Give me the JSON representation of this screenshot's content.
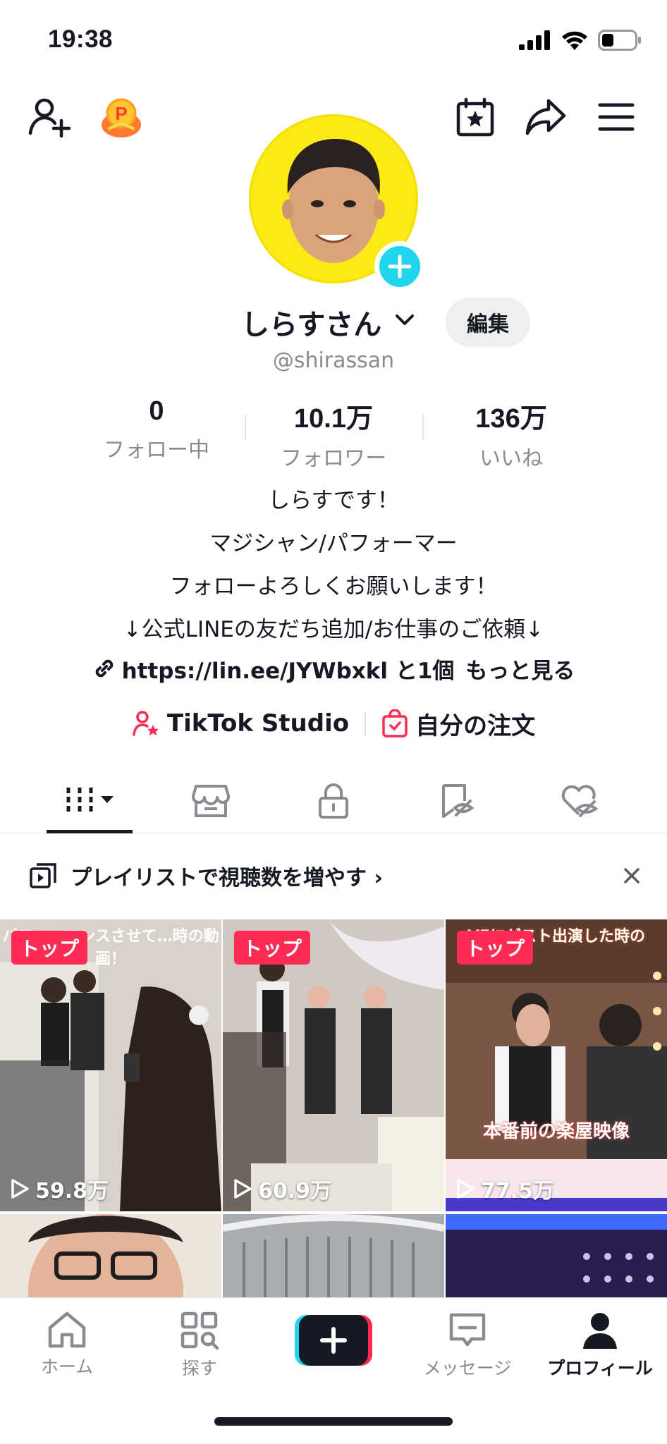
{
  "status": {
    "time": "19:38"
  },
  "profile": {
    "display_name": "しらすさん",
    "username": "@shirassan",
    "edit_label": "編集",
    "stats": [
      {
        "value": "0",
        "label": "フォロー中"
      },
      {
        "value": "10.1万",
        "label": "フォロワー"
      },
      {
        "value": "136万",
        "label": "いいね"
      }
    ],
    "bio_lines": [
      "しらすです！",
      "マジシャン/パフォーマー",
      "フォローよろしくお願いします！",
      "↓公式LINEの友だち追加/お仕事のご依頼↓"
    ],
    "link_text": "https://lin.ee/JYWbxkl と1個",
    "more_label": "もっと見る",
    "studio_label": "TikTok Studio",
    "orders_label": "自分の注文"
  },
  "playlist_banner": {
    "text": "プレイリストで視聴数を増やす ›"
  },
  "videos": [
    {
      "badge": "トップ",
      "views": "59.8万",
      "caption": "パフォーマンスさせて…時の動画！",
      "bg": "#bfb7ae"
    },
    {
      "badge": "トップ",
      "views": "60.9万",
      "caption": "",
      "bg": "#c9c3bc"
    },
    {
      "badge": "トップ",
      "views": "77.5万",
      "caption": "VEにゲスト出演した時の",
      "caption2": "本番前の楽屋映像",
      "bg": "#6e4a3a"
    },
    {
      "badge": "",
      "views": "",
      "caption": "",
      "bg": "#e6d6cc"
    },
    {
      "badge": "",
      "views": "",
      "caption": "",
      "bg": "#8d9094"
    },
    {
      "badge": "",
      "views": "",
      "caption": "",
      "bg": "#2b1c4f"
    }
  ],
  "bottom_nav": [
    {
      "label": "ホーム",
      "icon": "home-icon"
    },
    {
      "label": "探す",
      "icon": "discover-icon"
    },
    {
      "label": "",
      "icon": "create-icon"
    },
    {
      "label": "メッセージ",
      "icon": "inbox-icon"
    },
    {
      "label": "プロフィール",
      "icon": "profile-icon"
    }
  ],
  "colors": {
    "accent": "#fe2c55",
    "cyan": "#20d5ec",
    "avatar_bg": "#fcea14",
    "muted": "#8a8b91"
  }
}
